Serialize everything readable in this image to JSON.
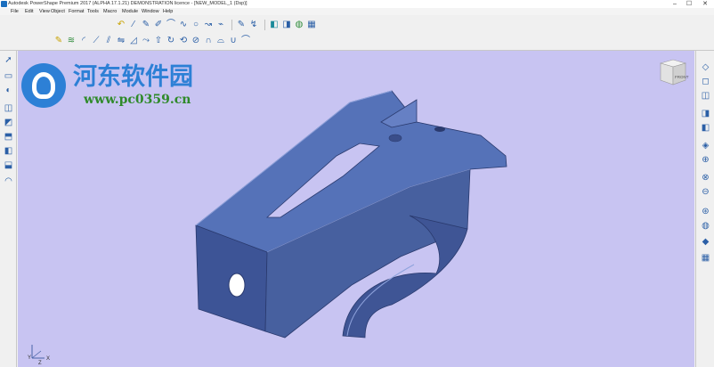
{
  "window": {
    "title": "Autodesk PowerShape Premium 2017 (ALPHA 17.1.21) DEMONSTRATION licence - [NEW_MODEL_1 (Dsp)]",
    "minimize": "–",
    "maximize": "☐",
    "close": "✕"
  },
  "menu": {
    "items": [
      "File",
      "Edit",
      "View",
      "Object",
      "Format",
      "Tools",
      "Macro",
      "Module",
      "Window",
      "Help"
    ]
  },
  "watermark": {
    "site": "河东软件园",
    "url": "www.pc0359.cn"
  },
  "viewcube": {
    "face_label": "FRONT"
  },
  "triad": {
    "y_axis": "Y",
    "x_axis": "X",
    "z_axis": "Z"
  },
  "colors": {
    "viewport_bg": "#c8c4f2",
    "model_blue": "#4a64a8",
    "watermark_blue": "#2d80d6",
    "watermark_green": "#2f8a2a"
  },
  "icons": {
    "toolbar_row1": [
      "new-icon",
      "open-icon",
      "save-icon",
      "print-icon",
      "cut-icon",
      "copy-icon",
      "paste-icon",
      "undo-icon",
      "redo-icon",
      "delete-icon",
      "select-icon",
      "zoom-icon",
      "wireframe-icon",
      "pan-icon",
      "rotate-icon",
      "line-icon",
      "arc-icon",
      "curve-icon",
      "circle-icon",
      "sketch-icon",
      "text-icon",
      "surface-icon",
      "solid-icon",
      "mesh-icon",
      "color-icon"
    ],
    "toolbar_row2": [
      "curve-edit-icon",
      "spline-icon",
      "blend-icon",
      "fillet-icon",
      "trim-icon",
      "offset-icon",
      "mirror-icon",
      "loft-icon",
      "sweep-icon",
      "extrude-icon",
      "revolve-icon",
      "project-icon",
      "wrap-icon",
      "shell-icon"
    ],
    "left_strip": [
      "select-arrow-icon",
      "workplane-icon",
      "point-icon",
      "line-tool-icon",
      "surface-tool-icon",
      "solid-tool-icon",
      "box-tool-icon",
      "shell-tool-icon",
      "mesh-tool-icon",
      "assembly-icon"
    ],
    "right_strip": [
      "view-iso-icon",
      "view-front-icon",
      "view-top-icon",
      "view-right-icon",
      "view-side-icon",
      "shade-icon",
      "zoom-all-icon",
      "zoom-in-icon",
      "zoom-out-icon",
      "zoom-window-icon",
      "fit-icon",
      "rotate-view-icon",
      "perspective-icon",
      "sphere-icon",
      "layer-icon",
      "grid-icon",
      "workplane-view-icon"
    ]
  }
}
